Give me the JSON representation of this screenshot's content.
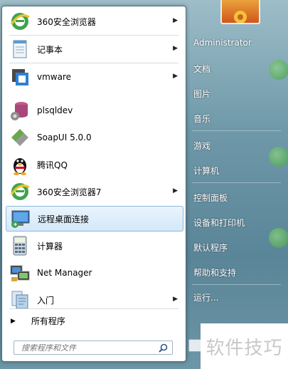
{
  "start_menu": {
    "programs": [
      {
        "label": "360安全浏览器",
        "icon": "ie-360-icon",
        "has_submenu": true
      },
      {
        "label": "记事本",
        "icon": "notepad-icon",
        "has_submenu": true
      },
      {
        "label": "vmware",
        "icon": "vmware-icon",
        "has_submenu": true
      },
      {
        "label": "plsqldev",
        "icon": "plsqldev-icon",
        "has_submenu": false
      },
      {
        "label": "SoapUI 5.0.0",
        "icon": "soapui-icon",
        "has_submenu": false
      },
      {
        "label": "腾讯QQ",
        "icon": "qq-penguin-icon",
        "has_submenu": false
      },
      {
        "label": "360安全浏览器7",
        "icon": "ie-360-icon",
        "has_submenu": true
      },
      {
        "label": "远程桌面连接",
        "icon": "remote-desktop-icon",
        "has_submenu": false,
        "highlighted": true
      },
      {
        "label": "计算器",
        "icon": "calculator-icon",
        "has_submenu": false
      },
      {
        "label": "Net Manager",
        "icon": "net-manager-icon",
        "has_submenu": false
      },
      {
        "label": "入门",
        "icon": "getting-started-icon",
        "has_submenu": true
      }
    ],
    "all_programs": "所有程序",
    "search_placeholder": "搜索程序和文件",
    "user": "Administrator",
    "places": [
      "文档",
      "图片",
      "音乐",
      "游戏",
      "计算机",
      "控制面板",
      "设备和打印机",
      "默认程序",
      "帮助和支持",
      "运行..."
    ]
  },
  "watermark": "软件技巧",
  "colors": {
    "highlight": "#d4e8f9",
    "highlight_border": "#90b7dd",
    "pane_bg": "#ffffff"
  }
}
